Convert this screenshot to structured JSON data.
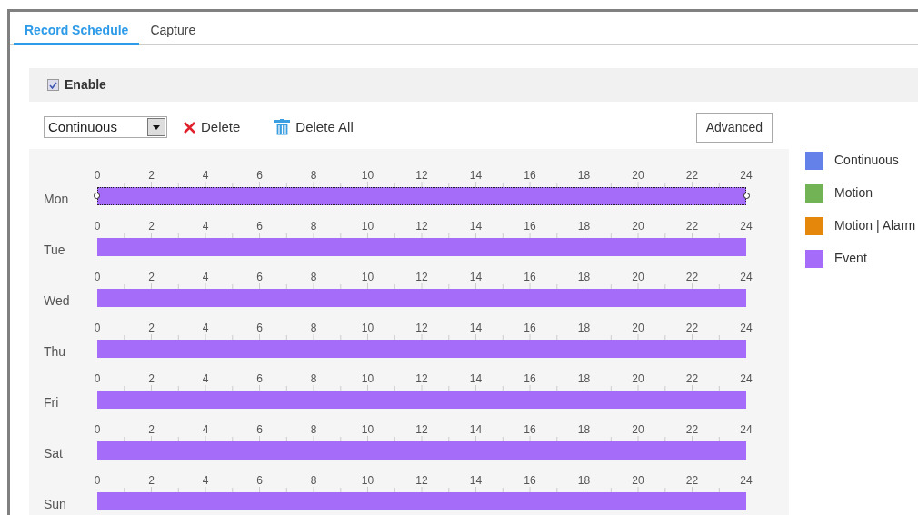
{
  "tabs": [
    {
      "label": "Record Schedule",
      "selected": true
    },
    {
      "label": "Capture",
      "selected": false
    }
  ],
  "enable": {
    "label": "Enable",
    "checked": true
  },
  "toolbar": {
    "type_select": "Continuous",
    "delete": "Delete",
    "delete_all": "Delete All",
    "advanced": "Advanced"
  },
  "days": [
    {
      "label": "Mon",
      "selected": true,
      "color": "#a46cf8",
      "ticks": [
        "0",
        "2",
        "4",
        "6",
        "8",
        "10",
        "12",
        "14",
        "16",
        "18",
        "20",
        "22",
        "24"
      ]
    },
    {
      "label": "Tue",
      "selected": false,
      "color": "#a46cf8",
      "ticks": [
        "0",
        "2",
        "4",
        "6",
        "8",
        "10",
        "12",
        "14",
        "16",
        "18",
        "20",
        "22",
        "24"
      ]
    },
    {
      "label": "Wed",
      "selected": false,
      "color": "#a46cf8",
      "ticks": [
        "0",
        "2",
        "4",
        "6",
        "8",
        "10",
        "12",
        "14",
        "16",
        "18",
        "20",
        "22",
        "24"
      ]
    },
    {
      "label": "Thu",
      "selected": false,
      "color": "#a46cf8",
      "ticks": [
        "0",
        "2",
        "4",
        "6",
        "8",
        "10",
        "12",
        "14",
        "16",
        "18",
        "20",
        "22",
        "24"
      ]
    },
    {
      "label": "Fri",
      "selected": false,
      "color": "#a46cf8",
      "ticks": [
        "0",
        "2",
        "4",
        "6",
        "8",
        "10",
        "12",
        "14",
        "16",
        "18",
        "20",
        "22",
        "24"
      ]
    },
    {
      "label": "Sat",
      "selected": false,
      "color": "#a46cf8",
      "ticks": [
        "0",
        "2",
        "4",
        "6",
        "8",
        "10",
        "12",
        "14",
        "16",
        "18",
        "20",
        "22",
        "24"
      ]
    },
    {
      "label": "Sun",
      "selected": false,
      "color": "#a46cf8",
      "ticks": [
        "0",
        "2",
        "4",
        "6",
        "8",
        "10",
        "12",
        "14",
        "16",
        "18",
        "20",
        "22",
        "24"
      ]
    }
  ],
  "legend": [
    {
      "label": "Continuous",
      "color": "#6381e8"
    },
    {
      "label": "Motion",
      "color": "#72b356"
    },
    {
      "label": "Motion | Alarm",
      "color": "#e5870a"
    },
    {
      "label": "Event",
      "color": "#a46cf8"
    }
  ]
}
